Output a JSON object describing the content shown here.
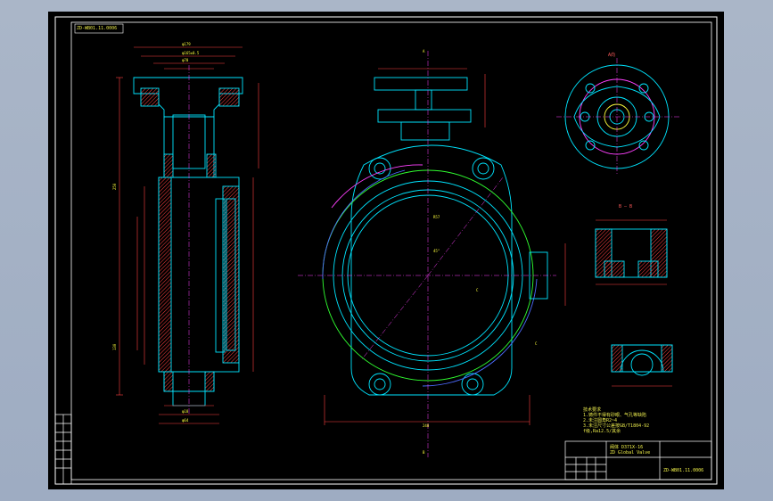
{
  "drawing": {
    "corner_label": "ZD-WB01.11.0006",
    "section_label_bb": "B — B",
    "view_label_a": "A向",
    "notes_title": "技术要求",
    "notes": [
      "1.铸件不得有砂眼、气孔等缺陷",
      "2.未注圆角R2~4",
      "3.未注尺寸公差按GB/T1804-92",
      "  f级,Ra12.5/其余"
    ],
    "title_block": {
      "part_name": "阀体 D371X-16",
      "company": "ZD Global Valve",
      "drawing_number": "ZD-WB01.11.0006"
    }
  },
  "colors": {
    "sheet": "#000000",
    "frame": "#ffffff",
    "outline": "#00e5ff",
    "hatch": "#ff4040",
    "dimension": "#ff4040",
    "text": "#ffff3c",
    "centerline": "#ff40ff",
    "hidden": "#30ff30",
    "arc_magenta": "#ff40ff",
    "arc_blue": "#4d6bff"
  }
}
